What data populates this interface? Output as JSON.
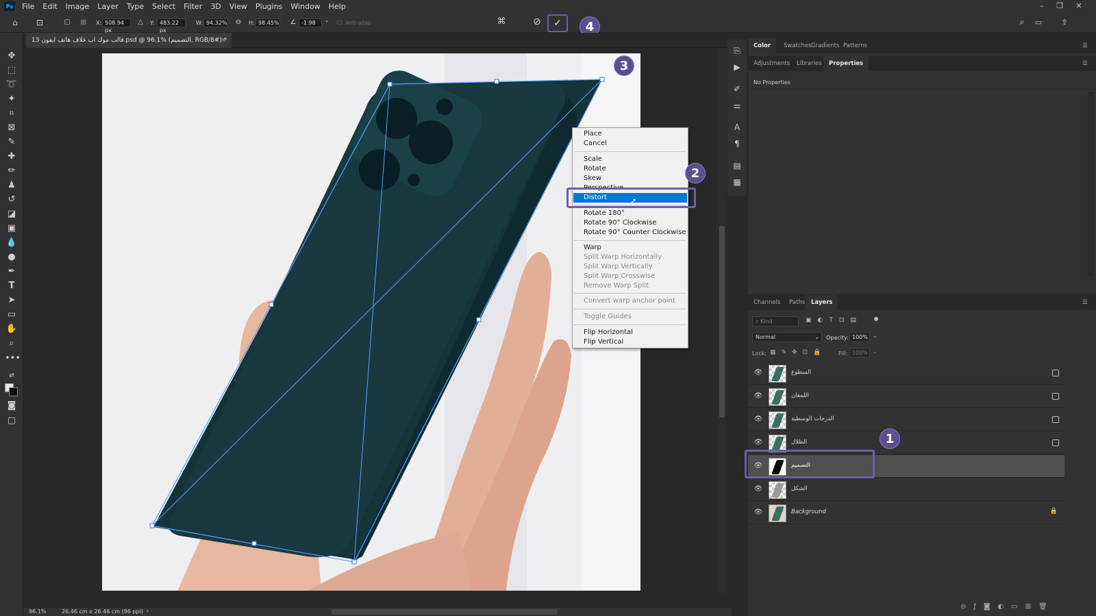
{
  "menubar": {
    "items": [
      "File",
      "Edit",
      "Image",
      "Layer",
      "Type",
      "Select",
      "Filter",
      "3D",
      "View",
      "Plugins",
      "Window",
      "Help"
    ]
  },
  "options": {
    "x_label": "X:",
    "x_value": "508.94 px",
    "y_label": "Y:",
    "y_value": "483.22 px",
    "w_label": "W:",
    "w_value": "94.32%",
    "h_label": "H:",
    "h_value": "98.45%",
    "angle_value": "-1.98",
    "angle_unit": "°",
    "antialias_label": "Anti-alias"
  },
  "document": {
    "tab_title": "قالب موك اب غلاف هاتف ايفون 13.psd @ 96.1% (التصميم, RGB/8#) *",
    "close_glyph": "×"
  },
  "status": {
    "zoom": "96.1%",
    "doc_info": "26.46 cm x 26.46 cm (96 ppi)"
  },
  "context_menu": {
    "group1": [
      "Place",
      "Cancel"
    ],
    "group2": [
      "Scale",
      "Rotate",
      "Skew",
      "Perspective",
      "Distort"
    ],
    "group3": [
      "Rotate 180°",
      "Rotate 90° Clockwise",
      "Rotate 90° Counter Clockwise"
    ],
    "group4": [
      "Warp",
      "Split Warp Horizontally",
      "Split Warp Vertically",
      "Split Warp Crosswise",
      "Remove Warp Split"
    ],
    "group5": [
      "Convert warp anchor point"
    ],
    "group6": [
      "Toggle Guides"
    ],
    "group7": [
      "Flip Horizontal",
      "Flip Vertical"
    ],
    "selected": "Distort"
  },
  "callouts": [
    "1",
    "2",
    "3",
    "4"
  ],
  "panels": {
    "top_tabs": [
      "Color",
      "Swatches",
      "Gradients",
      "Patterns"
    ],
    "second_tabs": [
      "Adjustments",
      "Libraries",
      "Properties"
    ],
    "properties_text": "No Properties",
    "layer_tabs": [
      "Channels",
      "Paths",
      "Layers"
    ],
    "kind_placeholder": "Kind",
    "blend_mode": "Normal",
    "opacity_label": "Opacity:",
    "opacity_value": "100%",
    "lock_label": "Lock:",
    "fill_label": "Fill:",
    "fill_value": "100%"
  },
  "layers": [
    {
      "name": "السطوع",
      "selected": false,
      "smart": true
    },
    {
      "name": "اللمعان",
      "selected": false,
      "smart": true
    },
    {
      "name": "الدرجات الوسطية",
      "selected": false,
      "smart": true
    },
    {
      "name": "الظلال",
      "selected": false,
      "smart": true
    },
    {
      "name": "التصميم",
      "selected": true,
      "smart": false
    },
    {
      "name": "الشكل",
      "selected": false,
      "smart": false
    },
    {
      "name": "Background",
      "selected": false,
      "smart": false,
      "locked": true
    }
  ],
  "colors": {
    "accent_purple": "#5b4f8f",
    "menu_highlight": "#0078d7",
    "phone_case": "#14343a",
    "transform_line": "#5aa0ff"
  }
}
